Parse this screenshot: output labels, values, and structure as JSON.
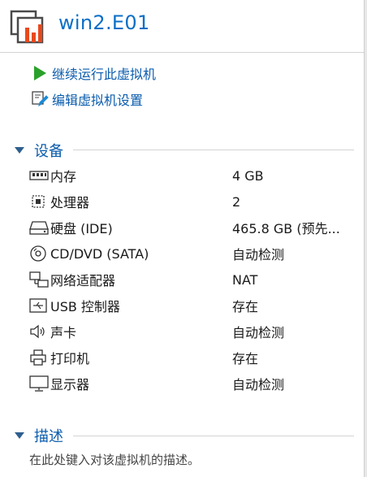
{
  "vm": {
    "title": "win2.E01",
    "logo_icon": "vm-window-icon",
    "accent_color": "#0b6fc6",
    "logo_accent_color": "#e8491d"
  },
  "actions": [
    {
      "label": "继续运行此虚拟机",
      "icon": "play-icon",
      "icon_color": "#2aa12a"
    },
    {
      "label": "编辑虚拟机设置",
      "icon": "edit-settings-icon",
      "icon_color": "#1d8ad6"
    }
  ],
  "devices_section": {
    "title": "设备",
    "items": [
      {
        "name": "内存",
        "value": "4 GB",
        "icon": "memory-icon"
      },
      {
        "name": "处理器",
        "value": "2",
        "icon": "processor-icon"
      },
      {
        "name": "硬盘 (IDE)",
        "value": "465.8 GB (预先...",
        "icon": "hard-disk-icon"
      },
      {
        "name": "CD/DVD (SATA)",
        "value": "自动检测",
        "icon": "cd-dvd-icon"
      },
      {
        "name": "网络适配器",
        "value": "NAT",
        "icon": "network-adapter-icon"
      },
      {
        "name": "USB 控制器",
        "value": "存在",
        "icon": "usb-icon"
      },
      {
        "name": "声卡",
        "value": "自动检测",
        "icon": "speaker-icon"
      },
      {
        "name": "打印机",
        "value": "存在",
        "icon": "printer-icon"
      },
      {
        "name": "显示器",
        "value": "自动检测",
        "icon": "display-icon"
      }
    ]
  },
  "description_section": {
    "title": "描述",
    "placeholder": "在此处键入对该虚拟机的描述。"
  }
}
